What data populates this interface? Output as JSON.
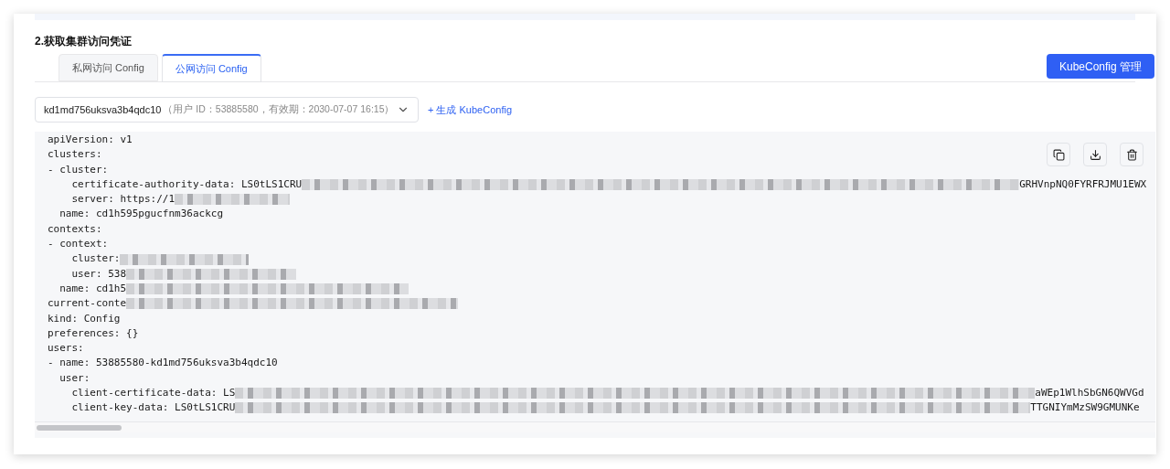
{
  "section_title": "2.获取集群访问凭证",
  "tabs": [
    {
      "label": "私网访问 Config",
      "selected": false
    },
    {
      "label": "公网访问 Config",
      "selected": true
    }
  ],
  "manage_button": "KubeConfig 管理",
  "config_select": {
    "value": "kd1md756uksva3b4qdc10",
    "detail": "（用户 ID：53885580，有效期：2030-07-07 16:15）"
  },
  "generate_link": "+ 生成 KubeConfig",
  "code_lines": [
    {
      "segments": [
        {
          "kind": "text",
          "text": "apiVersion: v1"
        }
      ]
    },
    {
      "segments": [
        {
          "kind": "text",
          "text": "clusters:"
        }
      ]
    },
    {
      "segments": [
        {
          "kind": "text",
          "text": "- cluster:"
        }
      ]
    },
    {
      "segments": [
        {
          "kind": "text",
          "text": "    certificate-authority-data: LS0tLS1CRU"
        },
        {
          "kind": "redacted"
        },
        {
          "kind": "text",
          "text": "GRHVnpNQ0FYRFRJMU1EWX"
        }
      ]
    },
    {
      "segments": [
        {
          "kind": "text",
          "text": "    server: https://1"
        },
        {
          "kind": "redacted"
        }
      ]
    },
    {
      "segments": [
        {
          "kind": "text",
          "text": "  name: cd1h595pgucfnm36ackcg"
        }
      ]
    },
    {
      "segments": [
        {
          "kind": "text",
          "text": "contexts:"
        }
      ]
    },
    {
      "segments": [
        {
          "kind": "text",
          "text": "- context:"
        }
      ]
    },
    {
      "segments": [
        {
          "kind": "text",
          "text": "    cluster:"
        },
        {
          "kind": "redacted"
        }
      ]
    },
    {
      "segments": [
        {
          "kind": "text",
          "text": "    user: 538"
        },
        {
          "kind": "redacted"
        }
      ]
    },
    {
      "segments": [
        {
          "kind": "text",
          "text": "  name: cd1h5"
        },
        {
          "kind": "redacted"
        }
      ]
    },
    {
      "segments": [
        {
          "kind": "text",
          "text": "current-conte"
        },
        {
          "kind": "redacted"
        }
      ]
    },
    {
      "segments": [
        {
          "kind": "text",
          "text": "kind: Config"
        }
      ]
    },
    {
      "segments": [
        {
          "kind": "text",
          "text": "preferences: {}"
        }
      ]
    },
    {
      "segments": [
        {
          "kind": "text",
          "text": "users:"
        }
      ]
    },
    {
      "segments": [
        {
          "kind": "text",
          "text": "- name: 53885580-kd1md756uksva3b4qdc10"
        }
      ]
    },
    {
      "segments": [
        {
          "kind": "text",
          "text": "  user:"
        }
      ]
    },
    {
      "segments": [
        {
          "kind": "text",
          "text": "    client-certificate-data: LS"
        },
        {
          "kind": "redacted"
        },
        {
          "kind": "text",
          "text": "aWEp1WlhSbGN6QWVGd"
        }
      ]
    },
    {
      "segments": [
        {
          "kind": "text",
          "text": "    client-key-data: LS0tLS1CRU"
        },
        {
          "kind": "redacted"
        },
        {
          "kind": "text",
          "text": "TTGNIYmMzSW9GMUNKe"
        }
      ]
    }
  ]
}
